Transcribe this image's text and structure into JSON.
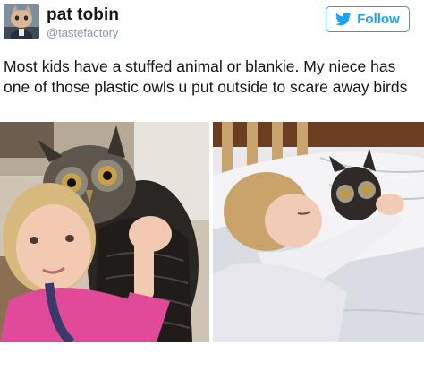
{
  "user": {
    "display_name": "pat tobin",
    "handle": "@tastefactory",
    "avatar_icon": "cat-avatar-icon"
  },
  "follow_button": {
    "label": "Follow",
    "icon": "twitter-bird-icon",
    "color": "#1da1f2"
  },
  "tweet": {
    "text": "Most kids have a stuffed animal or blankie. My niece has one of those plastic owls u put outside to scare away birds"
  },
  "photos": [
    {
      "icon": "photo-girl-hugging-owl"
    },
    {
      "icon": "photo-girl-sleeping-with-owl"
    }
  ]
}
